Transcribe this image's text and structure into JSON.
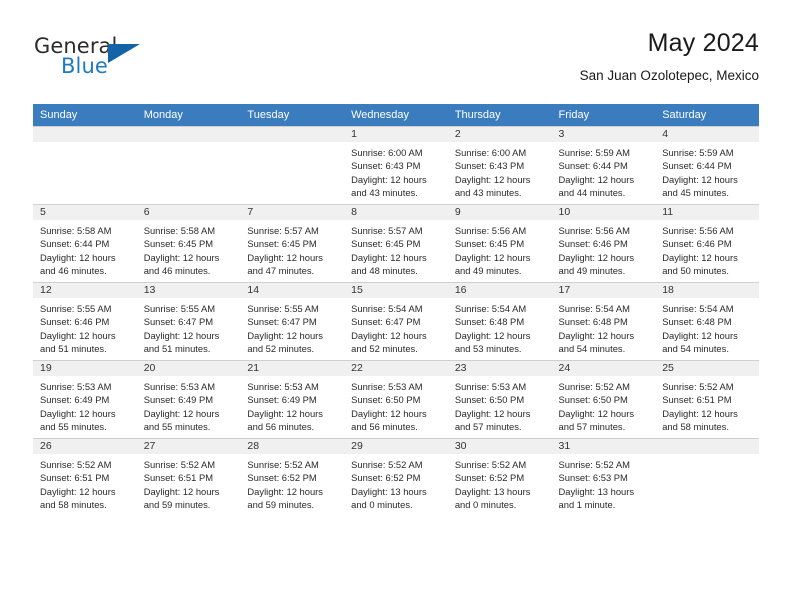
{
  "brand": {
    "name_part1": "General",
    "name_part2": "Blue",
    "flag_icon": "triangle-flag-icon",
    "accent_color": "#1263a8",
    "text_color": "#1f7bc1"
  },
  "header": {
    "title": "May 2024",
    "subtitle": "San Juan Ozolotepec, Mexico"
  },
  "calendar": {
    "header_background": "#3a7cbe",
    "daynum_background": "#f0f0f0",
    "weekday_headers": [
      "Sunday",
      "Monday",
      "Tuesday",
      "Wednesday",
      "Thursday",
      "Friday",
      "Saturday"
    ],
    "weeks": [
      [
        {
          "day": "",
          "sunrise": "",
          "sunset": "",
          "daylight_line1": "",
          "daylight_line2": "",
          "empty": true
        },
        {
          "day": "",
          "sunrise": "",
          "sunset": "",
          "daylight_line1": "",
          "daylight_line2": "",
          "empty": true
        },
        {
          "day": "",
          "sunrise": "",
          "sunset": "",
          "daylight_line1": "",
          "daylight_line2": "",
          "empty": true
        },
        {
          "day": "1",
          "sunrise": "Sunrise: 6:00 AM",
          "sunset": "Sunset: 6:43 PM",
          "daylight_line1": "Daylight: 12 hours",
          "daylight_line2": "and 43 minutes.",
          "empty": false
        },
        {
          "day": "2",
          "sunrise": "Sunrise: 6:00 AM",
          "sunset": "Sunset: 6:43 PM",
          "daylight_line1": "Daylight: 12 hours",
          "daylight_line2": "and 43 minutes.",
          "empty": false
        },
        {
          "day": "3",
          "sunrise": "Sunrise: 5:59 AM",
          "sunset": "Sunset: 6:44 PM",
          "daylight_line1": "Daylight: 12 hours",
          "daylight_line2": "and 44 minutes.",
          "empty": false
        },
        {
          "day": "4",
          "sunrise": "Sunrise: 5:59 AM",
          "sunset": "Sunset: 6:44 PM",
          "daylight_line1": "Daylight: 12 hours",
          "daylight_line2": "and 45 minutes.",
          "empty": false
        }
      ],
      [
        {
          "day": "5",
          "sunrise": "Sunrise: 5:58 AM",
          "sunset": "Sunset: 6:44 PM",
          "daylight_line1": "Daylight: 12 hours",
          "daylight_line2": "and 46 minutes.",
          "empty": false
        },
        {
          "day": "6",
          "sunrise": "Sunrise: 5:58 AM",
          "sunset": "Sunset: 6:45 PM",
          "daylight_line1": "Daylight: 12 hours",
          "daylight_line2": "and 46 minutes.",
          "empty": false
        },
        {
          "day": "7",
          "sunrise": "Sunrise: 5:57 AM",
          "sunset": "Sunset: 6:45 PM",
          "daylight_line1": "Daylight: 12 hours",
          "daylight_line2": "and 47 minutes.",
          "empty": false
        },
        {
          "day": "8",
          "sunrise": "Sunrise: 5:57 AM",
          "sunset": "Sunset: 6:45 PM",
          "daylight_line1": "Daylight: 12 hours",
          "daylight_line2": "and 48 minutes.",
          "empty": false
        },
        {
          "day": "9",
          "sunrise": "Sunrise: 5:56 AM",
          "sunset": "Sunset: 6:45 PM",
          "daylight_line1": "Daylight: 12 hours",
          "daylight_line2": "and 49 minutes.",
          "empty": false
        },
        {
          "day": "10",
          "sunrise": "Sunrise: 5:56 AM",
          "sunset": "Sunset: 6:46 PM",
          "daylight_line1": "Daylight: 12 hours",
          "daylight_line2": "and 49 minutes.",
          "empty": false
        },
        {
          "day": "11",
          "sunrise": "Sunrise: 5:56 AM",
          "sunset": "Sunset: 6:46 PM",
          "daylight_line1": "Daylight: 12 hours",
          "daylight_line2": "and 50 minutes.",
          "empty": false
        }
      ],
      [
        {
          "day": "12",
          "sunrise": "Sunrise: 5:55 AM",
          "sunset": "Sunset: 6:46 PM",
          "daylight_line1": "Daylight: 12 hours",
          "daylight_line2": "and 51 minutes.",
          "empty": false
        },
        {
          "day": "13",
          "sunrise": "Sunrise: 5:55 AM",
          "sunset": "Sunset: 6:47 PM",
          "daylight_line1": "Daylight: 12 hours",
          "daylight_line2": "and 51 minutes.",
          "empty": false
        },
        {
          "day": "14",
          "sunrise": "Sunrise: 5:55 AM",
          "sunset": "Sunset: 6:47 PM",
          "daylight_line1": "Daylight: 12 hours",
          "daylight_line2": "and 52 minutes.",
          "empty": false
        },
        {
          "day": "15",
          "sunrise": "Sunrise: 5:54 AM",
          "sunset": "Sunset: 6:47 PM",
          "daylight_line1": "Daylight: 12 hours",
          "daylight_line2": "and 52 minutes.",
          "empty": false
        },
        {
          "day": "16",
          "sunrise": "Sunrise: 5:54 AM",
          "sunset": "Sunset: 6:48 PM",
          "daylight_line1": "Daylight: 12 hours",
          "daylight_line2": "and 53 minutes.",
          "empty": false
        },
        {
          "day": "17",
          "sunrise": "Sunrise: 5:54 AM",
          "sunset": "Sunset: 6:48 PM",
          "daylight_line1": "Daylight: 12 hours",
          "daylight_line2": "and 54 minutes.",
          "empty": false
        },
        {
          "day": "18",
          "sunrise": "Sunrise: 5:54 AM",
          "sunset": "Sunset: 6:48 PM",
          "daylight_line1": "Daylight: 12 hours",
          "daylight_line2": "and 54 minutes.",
          "empty": false
        }
      ],
      [
        {
          "day": "19",
          "sunrise": "Sunrise: 5:53 AM",
          "sunset": "Sunset: 6:49 PM",
          "daylight_line1": "Daylight: 12 hours",
          "daylight_line2": "and 55 minutes.",
          "empty": false
        },
        {
          "day": "20",
          "sunrise": "Sunrise: 5:53 AM",
          "sunset": "Sunset: 6:49 PM",
          "daylight_line1": "Daylight: 12 hours",
          "daylight_line2": "and 55 minutes.",
          "empty": false
        },
        {
          "day": "21",
          "sunrise": "Sunrise: 5:53 AM",
          "sunset": "Sunset: 6:49 PM",
          "daylight_line1": "Daylight: 12 hours",
          "daylight_line2": "and 56 minutes.",
          "empty": false
        },
        {
          "day": "22",
          "sunrise": "Sunrise: 5:53 AM",
          "sunset": "Sunset: 6:50 PM",
          "daylight_line1": "Daylight: 12 hours",
          "daylight_line2": "and 56 minutes.",
          "empty": false
        },
        {
          "day": "23",
          "sunrise": "Sunrise: 5:53 AM",
          "sunset": "Sunset: 6:50 PM",
          "daylight_line1": "Daylight: 12 hours",
          "daylight_line2": "and 57 minutes.",
          "empty": false
        },
        {
          "day": "24",
          "sunrise": "Sunrise: 5:52 AM",
          "sunset": "Sunset: 6:50 PM",
          "daylight_line1": "Daylight: 12 hours",
          "daylight_line2": "and 57 minutes.",
          "empty": false
        },
        {
          "day": "25",
          "sunrise": "Sunrise: 5:52 AM",
          "sunset": "Sunset: 6:51 PM",
          "daylight_line1": "Daylight: 12 hours",
          "daylight_line2": "and 58 minutes.",
          "empty": false
        }
      ],
      [
        {
          "day": "26",
          "sunrise": "Sunrise: 5:52 AM",
          "sunset": "Sunset: 6:51 PM",
          "daylight_line1": "Daylight: 12 hours",
          "daylight_line2": "and 58 minutes.",
          "empty": false
        },
        {
          "day": "27",
          "sunrise": "Sunrise: 5:52 AM",
          "sunset": "Sunset: 6:51 PM",
          "daylight_line1": "Daylight: 12 hours",
          "daylight_line2": "and 59 minutes.",
          "empty": false
        },
        {
          "day": "28",
          "sunrise": "Sunrise: 5:52 AM",
          "sunset": "Sunset: 6:52 PM",
          "daylight_line1": "Daylight: 12 hours",
          "daylight_line2": "and 59 minutes.",
          "empty": false
        },
        {
          "day": "29",
          "sunrise": "Sunrise: 5:52 AM",
          "sunset": "Sunset: 6:52 PM",
          "daylight_line1": "Daylight: 13 hours",
          "daylight_line2": "and 0 minutes.",
          "empty": false
        },
        {
          "day": "30",
          "sunrise": "Sunrise: 5:52 AM",
          "sunset": "Sunset: 6:52 PM",
          "daylight_line1": "Daylight: 13 hours",
          "daylight_line2": "and 0 minutes.",
          "empty": false
        },
        {
          "day": "31",
          "sunrise": "Sunrise: 5:52 AM",
          "sunset": "Sunset: 6:53 PM",
          "daylight_line1": "Daylight: 13 hours",
          "daylight_line2": "and 1 minute.",
          "empty": false
        },
        {
          "day": "",
          "sunrise": "",
          "sunset": "",
          "daylight_line1": "",
          "daylight_line2": "",
          "empty": true
        }
      ]
    ]
  }
}
